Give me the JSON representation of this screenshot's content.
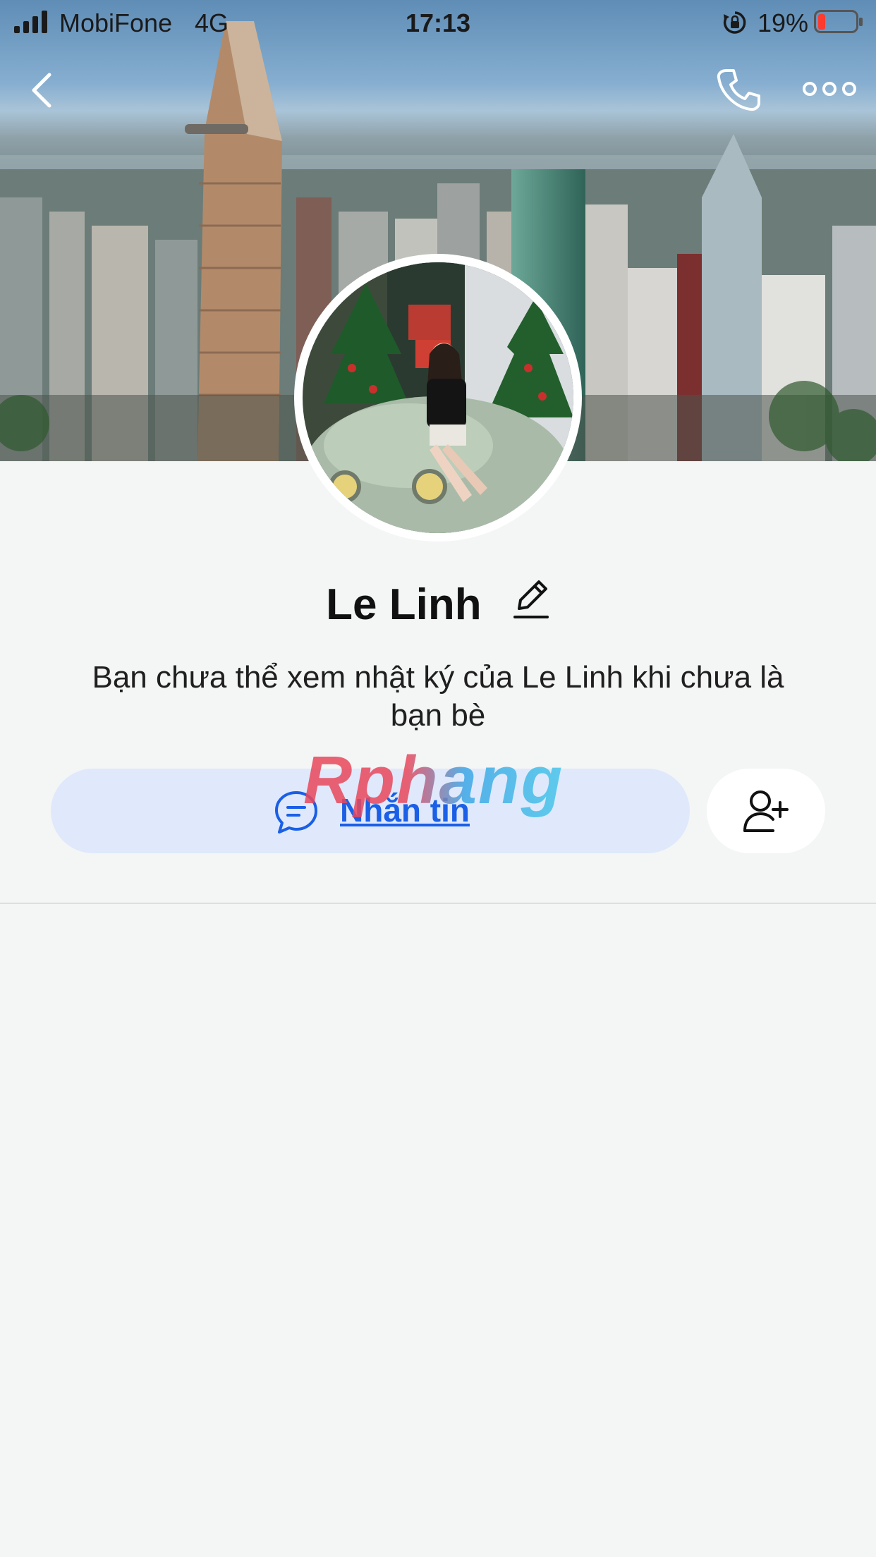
{
  "status_bar": {
    "carrier": "MobiFone",
    "network": "4G",
    "time": "17:13",
    "battery_percent": "19%",
    "battery_level": 0.19,
    "battery_color": "#ff3b30"
  },
  "nav": {
    "back_icon": "chevron-left-icon",
    "call_icon": "phone-icon",
    "more_icon": "more-dots-icon"
  },
  "profile": {
    "name": "Le Linh",
    "notice": "Bạn chưa thể xem nhật ký của Le Linh khi chưa là bạn bè"
  },
  "actions": {
    "message_label": "Nhắn tin",
    "message_icon": "chat-bubble-icon",
    "add_friend_icon": "add-friend-icon"
  },
  "watermark": {
    "text": "Rphang"
  },
  "colors": {
    "accent": "#1a5fe6",
    "message_button_bg": "#dfe9fb",
    "background": "#f4f5f5"
  }
}
